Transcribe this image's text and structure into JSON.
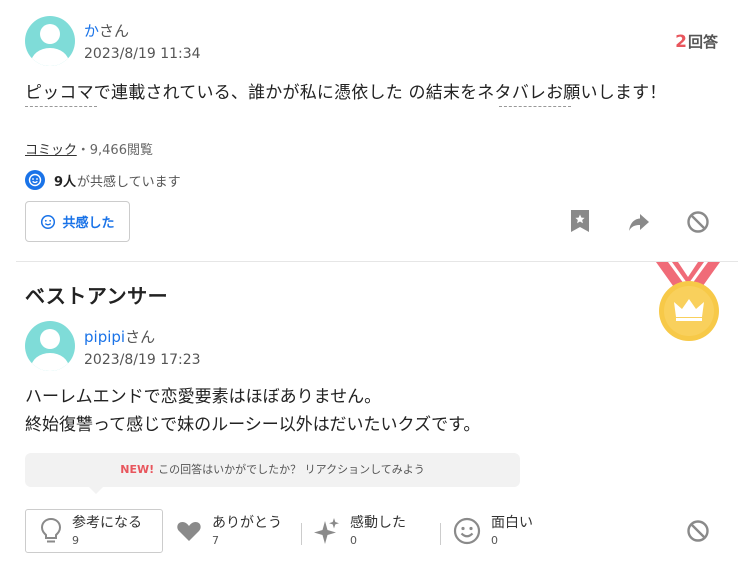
{
  "question": {
    "user": {
      "name": "か",
      "suffix": "さん",
      "date": "2023/8/19 11:34"
    },
    "answers": {
      "count": "2",
      "label": "回答"
    },
    "text": "ピッコマで連載されている、誰かが私に憑依した の結末をネタバレお願いします！",
    "category": "コミック",
    "views": "・9,466閲覧",
    "empathy": {
      "count": "9人",
      "suffix": "が共感しています"
    },
    "empathy_button": "共感した",
    "icons": [
      "bookmark-icon",
      "share-icon",
      "block-icon"
    ]
  },
  "best_answer": {
    "title": "ベストアンサー",
    "user": {
      "name": "pipipi",
      "suffix": "さん",
      "date": "2023/8/19 17:23"
    },
    "lines": [
      "ハーレムエンドで恋愛要素はほぼありません。",
      "終始復讐って感じで妹のルーシー以外はだいたいクズです。"
    ],
    "promo": {
      "new": "NEW!",
      "text": "この回答はいかがでしたか？ リアクションしてみよう"
    },
    "reactions": [
      {
        "label": "参考になる",
        "count": "9",
        "icon": "lightbulb-icon"
      },
      {
        "label": "ありがとう",
        "count": "7",
        "icon": "heart-icon"
      },
      {
        "label": "感動した",
        "count": "0",
        "icon": "sparkle-icon"
      },
      {
        "label": "面白い",
        "count": "0",
        "icon": "smile-icon"
      }
    ]
  },
  "colors": {
    "accent_blue": "#1a73e8",
    "count_red": "#e8565d",
    "avatar": "#7fdcd8",
    "medal_gold": "#f7c948",
    "ribbon": "#f06b78"
  }
}
